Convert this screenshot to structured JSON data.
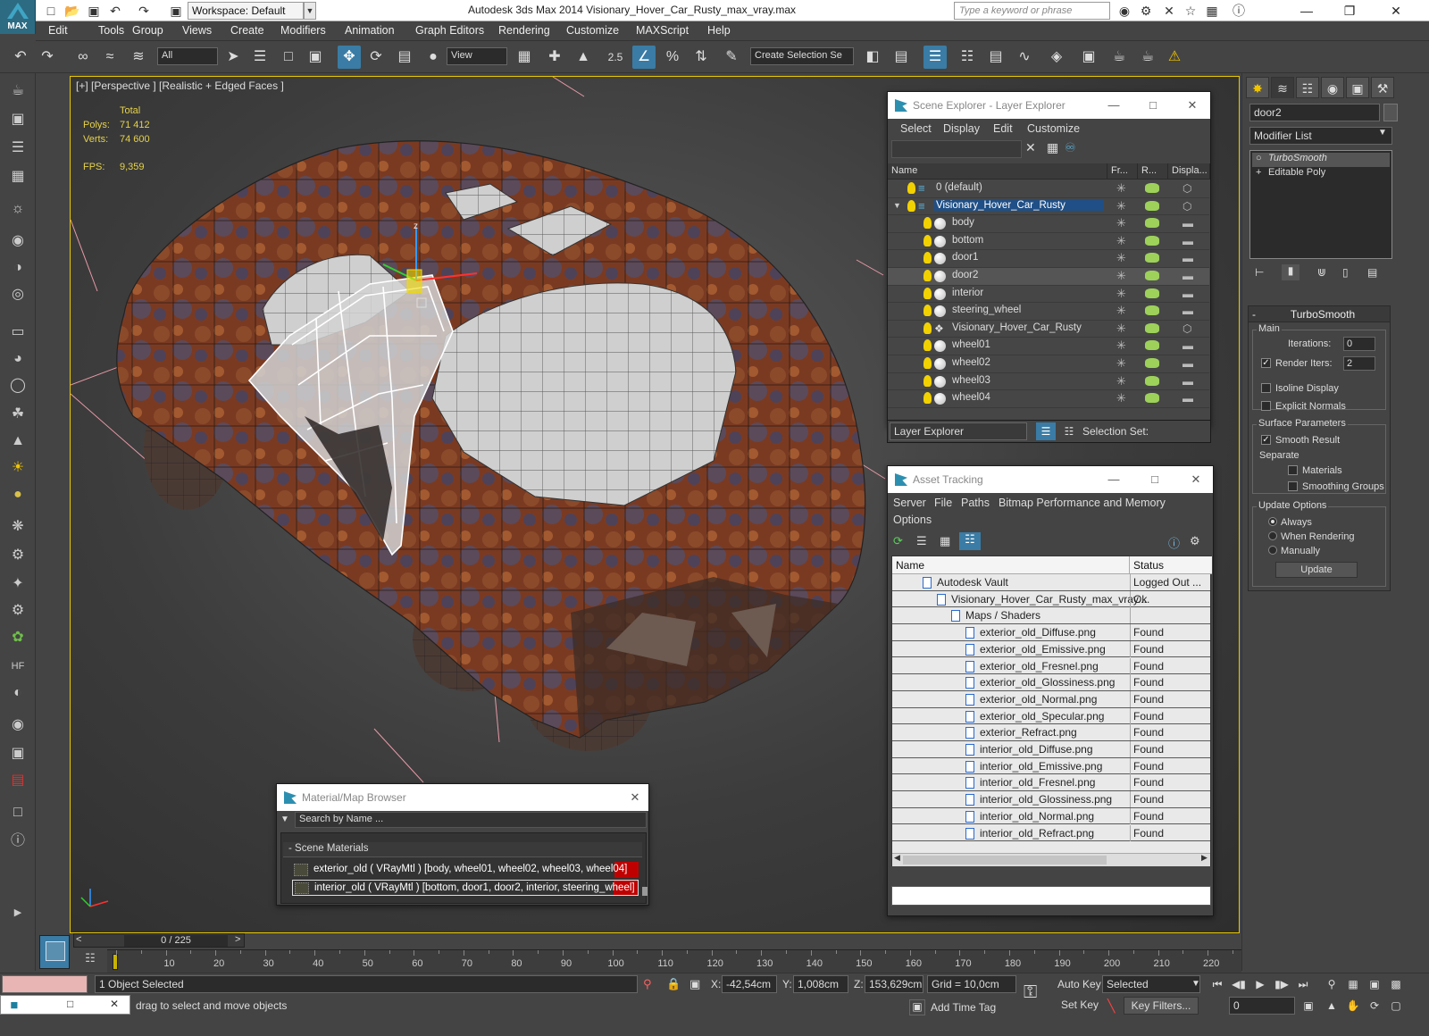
{
  "app": {
    "title": "Autodesk 3ds Max  2014    Visionary_Hover_Car_Rusty_max_vray.max",
    "logo_text": "MAX",
    "workspace": "Workspace: Default",
    "search_placeholder": "Type a keyword or phrase"
  },
  "menu": [
    "Edit",
    "Tools",
    "Group",
    "Views",
    "Create",
    "Modifiers",
    "Animation",
    "Graph Editors",
    "Rendering",
    "Customize",
    "MAXScript",
    "Help"
  ],
  "toolbar": {
    "filter": "All",
    "ref_coord": "View",
    "snap_angle": "2.5",
    "selection_set_placeholder": "Create Selection Se"
  },
  "viewport": {
    "label": "[+] [Perspective ] [Realistic + Edged Faces ]",
    "stats_header": "Total",
    "polys_label": "Polys:",
    "polys_value": "71 412",
    "verts_label": "Verts:",
    "verts_value": "74 600",
    "fps_label": "FPS:",
    "fps_value": "9,359",
    "axis_z": "z"
  },
  "command_panel": {
    "object_name": "door2",
    "modifier_list": "Modifier List",
    "stack": [
      "TurboSmooth",
      "Editable Poly"
    ],
    "turbosmooth": {
      "title": "TurboSmooth",
      "main": "Main",
      "iterations_label": "Iterations:",
      "iterations": "0",
      "render_iters_label": "Render Iters:",
      "render_iters": "2",
      "isoline": "Isoline Display",
      "explicit": "Explicit Normals",
      "surface": "Surface Parameters",
      "smooth_result": "Smooth Result",
      "separate": "Separate",
      "materials": "Materials",
      "smoothing_groups": "Smoothing Groups",
      "update_options": "Update Options",
      "always": "Always",
      "when_rendering": "When Rendering",
      "manually": "Manually",
      "update": "Update"
    }
  },
  "scene_explorer": {
    "title": "Scene Explorer - Layer Explorer",
    "menu": [
      "Select",
      "Display",
      "Edit",
      "Customize"
    ],
    "columns": [
      "Name",
      "Fr...",
      "R...",
      "Displa..."
    ],
    "rows": [
      {
        "name": "0 (default)",
        "indent": 0,
        "type": "layer"
      },
      {
        "name": "Visionary_Hover_Car_Rusty",
        "indent": 0,
        "type": "layer",
        "selected": true
      },
      {
        "name": "body",
        "indent": 1,
        "type": "obj"
      },
      {
        "name": "bottom",
        "indent": 1,
        "type": "obj"
      },
      {
        "name": "door1",
        "indent": 1,
        "type": "obj"
      },
      {
        "name": "door2",
        "indent": 1,
        "type": "obj",
        "highlight": true
      },
      {
        "name": "interior",
        "indent": 1,
        "type": "obj"
      },
      {
        "name": "steering_wheel",
        "indent": 1,
        "type": "obj"
      },
      {
        "name": "Visionary_Hover_Car_Rusty",
        "indent": 1,
        "type": "group"
      },
      {
        "name": "wheel01",
        "indent": 1,
        "type": "obj"
      },
      {
        "name": "wheel02",
        "indent": 1,
        "type": "obj"
      },
      {
        "name": "wheel03",
        "indent": 1,
        "type": "obj"
      },
      {
        "name": "wheel04",
        "indent": 1,
        "type": "obj"
      }
    ],
    "footer_dropdown": "Layer Explorer",
    "selection_set": "Selection Set:"
  },
  "asset_tracking": {
    "title": "Asset Tracking",
    "menu": [
      "Server",
      "File",
      "Paths",
      "Bitmap Performance and Memory",
      "Options"
    ],
    "columns": [
      "Name",
      "Status"
    ],
    "rows": [
      {
        "name": "Autodesk Vault",
        "status": "Logged Out ...",
        "indent": 1
      },
      {
        "name": "Visionary_Hover_Car_Rusty_max_vray....",
        "status": "Ok",
        "indent": 2
      },
      {
        "name": "Maps / Shaders",
        "status": "",
        "indent": 3
      },
      {
        "name": "exterior_old_Diffuse.png",
        "status": "Found",
        "indent": 4
      },
      {
        "name": "exterior_old_Emissive.png",
        "status": "Found",
        "indent": 4
      },
      {
        "name": "exterior_old_Fresnel.png",
        "status": "Found",
        "indent": 4
      },
      {
        "name": "exterior_old_Glossiness.png",
        "status": "Found",
        "indent": 4
      },
      {
        "name": "exterior_old_Normal.png",
        "status": "Found",
        "indent": 4
      },
      {
        "name": "exterior_old_Specular.png",
        "status": "Found",
        "indent": 4
      },
      {
        "name": "exterior_Refract.png",
        "status": "Found",
        "indent": 4
      },
      {
        "name": "interior_old_Diffuse.png",
        "status": "Found",
        "indent": 4
      },
      {
        "name": "interior_old_Emissive.png",
        "status": "Found",
        "indent": 4
      },
      {
        "name": "interior_old_Fresnel.png",
        "status": "Found",
        "indent": 4
      },
      {
        "name": "interior_old_Glossiness.png",
        "status": "Found",
        "indent": 4
      },
      {
        "name": "interior_old_Normal.png",
        "status": "Found",
        "indent": 4
      },
      {
        "name": "interior_old_Refract.png",
        "status": "Found",
        "indent": 4
      }
    ]
  },
  "material_browser": {
    "title": "Material/Map Browser",
    "search_placeholder": "Search by Name ...",
    "group": "Scene Materials",
    "items": [
      "exterior_old  ( VRayMtl )  [body, wheel01, wheel02, wheel03, wheel04]",
      "interior_old  ( VRayMtl )  [bottom, door1, door2, interior, steering_wheel]"
    ]
  },
  "timeline": {
    "frame": "0 / 225",
    "ticks": [
      "10",
      "20",
      "30",
      "40",
      "50",
      "60",
      "70",
      "80",
      "90",
      "100",
      "110",
      "120",
      "130",
      "140",
      "150",
      "160",
      "170",
      "180",
      "190",
      "200",
      "210",
      "220"
    ]
  },
  "status": {
    "selected": "1 Object Selected",
    "prompt": "drag to select and move objects",
    "x_label": "X:",
    "x": "-42,54cm",
    "y_label": "Y:",
    "y": "1,008cm",
    "z_label": "Z:",
    "z": "153,629cm",
    "grid": "Grid = 10,0cm",
    "auto_key": "Auto Key",
    "set_key": "Set Key",
    "key_mode": "Selected",
    "key_filters": "Key Filters...",
    "add_time_tag": "Add Time Tag",
    "frame_field": "0"
  }
}
